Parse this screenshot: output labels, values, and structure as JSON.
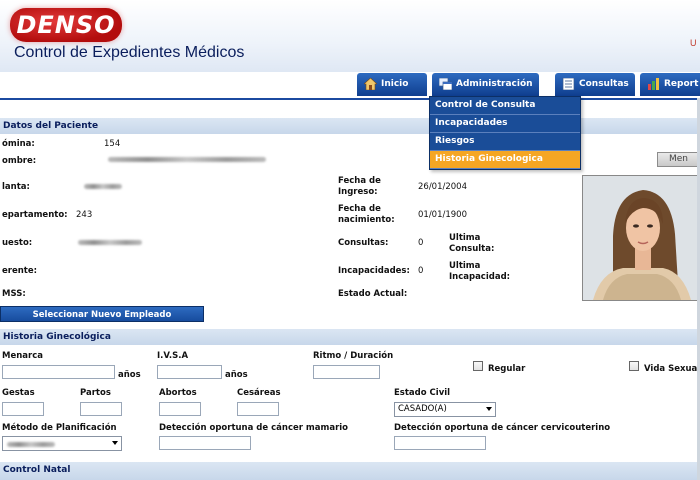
{
  "header": {
    "logo": "DENSO",
    "app_title": "Control de Expedientes Médicos",
    "user_hint": "U"
  },
  "nav": {
    "tabs": [
      {
        "label": "Inicio",
        "icon": "home-icon"
      },
      {
        "label": "Administración",
        "icon": "windows-icon"
      },
      {
        "label": "Consultas",
        "icon": "list-icon"
      },
      {
        "label": "Report",
        "icon": "chart-icon"
      }
    ],
    "dropdown": [
      {
        "label": "Control de Consulta",
        "active": false
      },
      {
        "label": "Incapacidades",
        "active": false
      },
      {
        "label": "Riesgos",
        "active": false
      },
      {
        "label": "Historia Ginecologica",
        "active": true
      }
    ]
  },
  "patient": {
    "section_title": "Datos del Paciente",
    "nomina_label": "ómina:",
    "nomina_value": "154",
    "nombre_label": "ombre:",
    "planta_label": "lanta:",
    "departamento_label": "epartamento:",
    "departamento_value": "243",
    "puesto_label": "uesto:",
    "gerente_label": "erente:",
    "imss_label": "MSS:",
    "fecha_ingreso_label_1": "Fecha de",
    "fecha_ingreso_label_2": "Ingreso:",
    "fecha_ingreso_value": "26/01/2004",
    "fecha_nac_label_1": "Fecha de",
    "fecha_nac_label_2": "nacimiento:",
    "fecha_nac_value": "01/01/1900",
    "consultas_label": "Consultas:",
    "consultas_value": "0",
    "ultima_consulta_1": "Ultima",
    "ultima_consulta_2": "Consulta:",
    "incapacidades_label": "Incapacidades:",
    "incapacidades_value": "0",
    "ultima_incap_1": "Ultima",
    "ultima_incap_2": "Incapacidad:",
    "estado_actual_label": "Estado Actual:",
    "select_button": "Seleccionar Nuevo Empleado",
    "men_button": "Men"
  },
  "gyn": {
    "section_title": "Historia Ginecológica",
    "menarca_label": "Menarca",
    "anos_1": "años",
    "ivsa_label": "I.V.S.A",
    "anos_2": "años",
    "ritmo_label": "Ritmo / Duración",
    "regular_label": "Regular",
    "vida_sexual_label": "Vida Sexua",
    "gestas_label": "Gestas",
    "partos_label": "Partos",
    "abortos_label": "Abortos",
    "cesareas_label": "Cesáreas",
    "estado_civil_label": "Estado Civil",
    "estado_civil_value": "CASADO(A)",
    "metodo_label": "Método de Planificación",
    "mamario_label": "Detección oportuna de cáncer mamario",
    "cervico_label": "Detección oportuna de cáncer cervicouterino"
  },
  "natal": {
    "section_title": "Control Natal"
  },
  "colors": {
    "nav_blue": "#1b4aa0",
    "dropdown_active": "#f5a623",
    "section_bg": "#c7d7ea",
    "logo_red": "#c41414"
  }
}
